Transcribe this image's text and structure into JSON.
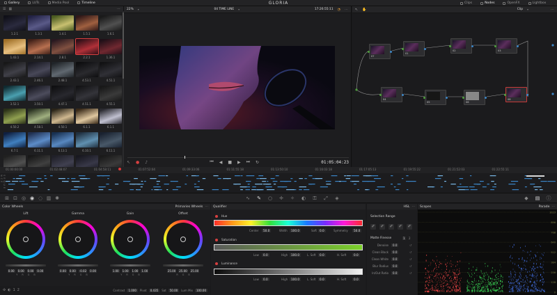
{
  "topbar": {
    "tabs": [
      {
        "label": "Gallery",
        "active": true
      },
      {
        "label": "LUTs",
        "active": false
      },
      {
        "label": "Media Pool",
        "active": false
      },
      {
        "label": "Timeline",
        "active": true
      }
    ],
    "title": "GLORIA",
    "right_tabs": [
      {
        "label": "Clips"
      },
      {
        "label": "Nodes"
      },
      {
        "label": "OpenFX"
      },
      {
        "label": "Lightbox"
      }
    ]
  },
  "gallery": {
    "thumbs": [
      {
        "label": "1.2.1",
        "colors": [
          "#101018",
          "#2a2a3e"
        ]
      },
      {
        "label": "1.3.1",
        "colors": [
          "#222244",
          "#5a5a88"
        ]
      },
      {
        "label": "1.4.1",
        "colors": [
          "#4a5a20",
          "#c8c070"
        ]
      },
      {
        "label": "1.5.1",
        "colors": [
          "#301818",
          "#a06040"
        ]
      },
      {
        "label": "1.6.1",
        "colors": [
          "#1a1a1a",
          "#505050"
        ]
      },
      {
        "label": "1.43.1",
        "colors": [
          "#a07028",
          "#e8c080"
        ]
      },
      {
        "label": "2.14.1",
        "colors": [
          "#402018",
          "#b87050"
        ]
      },
      {
        "label": "2.8.1",
        "colors": [
          "#281820",
          "#805040"
        ]
      },
      {
        "label": "2.2.1",
        "colors": [
          "#301018",
          "#b03038"
        ],
        "selected": true
      },
      {
        "label": "1.36.1",
        "colors": [
          "#201018",
          "#702830"
        ]
      },
      {
        "label": "2.43.1",
        "colors": [
          "#181818",
          "#404048"
        ]
      },
      {
        "label": "2.46.1",
        "colors": [
          "#1a1a22",
          "#484858"
        ]
      },
      {
        "label": "2.48.1",
        "colors": [
          "#202428",
          "#606870"
        ]
      },
      {
        "label": "4.53.1",
        "colors": [
          "#0e0e10",
          "#2a2a2e"
        ]
      },
      {
        "label": "4.51.1",
        "colors": [
          "#121214",
          "#303036"
        ]
      },
      {
        "label": "3.52.1",
        "colors": [
          "#102a30",
          "#4aa0b0"
        ]
      },
      {
        "label": "3.50.1",
        "colors": [
          "#181820",
          "#4c4c5c"
        ]
      },
      {
        "label": "4.47.1",
        "colors": [
          "#101012",
          "#28282e"
        ]
      },
      {
        "label": "4.51.1",
        "colors": [
          "#141416",
          "#34343a"
        ]
      },
      {
        "label": "4.55.1",
        "colors": [
          "#181818",
          "#3a3a3a"
        ]
      },
      {
        "label": "4.50.2",
        "colors": [
          "#2a3018",
          "#90a050"
        ]
      },
      {
        "label": "4.58.1",
        "colors": [
          "#283020",
          "#a0b080"
        ]
      },
      {
        "label": "4.50.1",
        "colors": [
          "#2a2418",
          "#d0b890"
        ]
      },
      {
        "label": "6.1.1",
        "colors": [
          "#3a2a18",
          "#e0c8a0"
        ]
      },
      {
        "label": "6.1.1",
        "colors": [
          "#2a2a30",
          "#c0c0d0"
        ]
      },
      {
        "label": "6.7.1",
        "colors": [
          "#102040",
          "#4080c0"
        ]
      },
      {
        "label": "6.11.1",
        "colors": [
          "#203050",
          "#5c8cc8"
        ]
      },
      {
        "label": "6.13.1",
        "colors": [
          "#183050",
          "#5888c0"
        ]
      },
      {
        "label": "6.10.1",
        "colors": [
          "#203040",
          "#6090b0"
        ]
      },
      {
        "label": "6.11.1",
        "colors": [
          "#1a2230",
          "#485868"
        ]
      },
      {
        "label": "",
        "colors": [
          "#202020",
          "#505050"
        ]
      },
      {
        "label": "",
        "colors": [
          "#181818",
          "#404040"
        ]
      },
      {
        "label": "",
        "colors": [
          "#202028",
          "#404050"
        ]
      },
      {
        "label": "",
        "colors": [
          "#181820",
          "#383848"
        ]
      },
      {
        "label": "",
        "colors": [
          "#1a1a1a",
          "#3a3a3a"
        ]
      }
    ]
  },
  "viewer": {
    "zoom": "22%",
    "timeline_name": "04 TIME LINE",
    "timecode_top": "17:26:55:11",
    "timecode": "01:05:04:23"
  },
  "nodes": {
    "mode": "Clip",
    "items": [
      {
        "label": "07"
      },
      {
        "label": "01"
      },
      {
        "label": "02"
      },
      {
        "label": "03"
      },
      {
        "label": "04"
      },
      {
        "label": "05"
      },
      {
        "label": "06"
      },
      {
        "label": "08"
      }
    ]
  },
  "timeline": {
    "timecodes": [
      "01:00:00:00",
      "01:02:48:07",
      "01:04:58:11",
      "01:07:52:04",
      "01:09:33:06",
      "01:11:55:18",
      "01:13:50:10",
      "01:16:03:18",
      "01:17:05:13",
      "01:19:55:22",
      "01:21:52:03",
      "01:22:55:11"
    ],
    "track_label": "S E Q U E N C E"
  },
  "color_wheels": {
    "title": "Color Wheels",
    "mode": "Primaries Wheels",
    "wheels": [
      {
        "name": "Lift",
        "values": [
          "0.00",
          "0.00",
          "0.00",
          "0.00"
        ],
        "channels": [
          "Y",
          "R",
          "G",
          "B"
        ]
      },
      {
        "name": "Gamma",
        "values": [
          "0.00",
          "0.00",
          "-0.02",
          "0.00"
        ],
        "channels": [
          "Y",
          "R",
          "G",
          "B"
        ]
      },
      {
        "name": "Gain",
        "values": [
          "1.00",
          "1.00",
          "1.00",
          "1.00"
        ],
        "channels": [
          "Y",
          "R",
          "G",
          "B"
        ]
      },
      {
        "name": "Offset",
        "values": [
          "25.00",
          "25.00",
          "25.00"
        ],
        "channels": [
          "R",
          "G",
          "B"
        ]
      }
    ],
    "footer": {
      "contrast_label": "Contrast",
      "contrast": "1.000",
      "pivot_label": "Pivot",
      "pivot": "0.435",
      "sat_label": "Sat",
      "sat": "50.00",
      "lummix_label": "Lum Mix",
      "lummix": "100.00"
    }
  },
  "qualifier": {
    "title": "Qualifier",
    "mode": "HSL",
    "hue": {
      "label": "Hue",
      "center_label": "Center",
      "center": "50.0",
      "width_label": "Width",
      "width": "100.0",
      "soft_label": "Soft",
      "soft": "0.0",
      "symmetry_label": "Symmetry",
      "symmetry": "50.0"
    },
    "saturation": {
      "label": "Saturation",
      "low_label": "Low",
      "low": "0.0",
      "high_label": "High",
      "high": "100.0",
      "lsoft_label": "L. Soft",
      "lsoft": "0.0",
      "hsoft_label": "H. Soft",
      "hsoft": "0.0"
    },
    "luminance": {
      "label": "Luminance",
      "low_label": "Low",
      "low": "0.0",
      "high_label": "High",
      "high": "100.0",
      "lsoft_label": "L. Soft",
      "lsoft": "0.0",
      "hsoft_label": "H. Soft",
      "hsoft": "0.0"
    }
  },
  "selection": {
    "title": "Selection Range",
    "matte_title": "Matte Finesse",
    "pages": [
      "1",
      "2"
    ],
    "rows": [
      {
        "label": "Denoise",
        "value": "0.0"
      },
      {
        "label": "Clean Black",
        "value": "0.0"
      },
      {
        "label": "Clean White",
        "value": "0.0"
      },
      {
        "label": "Blur Radius",
        "value": "0.0"
      },
      {
        "label": "In/Out Ratio",
        "value": "0.0"
      }
    ]
  },
  "scopes": {
    "title": "Scopes",
    "mode": "Parade",
    "scale": [
      "1023",
      "896",
      "768",
      "640",
      "512",
      "384",
      "256",
      "128",
      "0"
    ],
    "colors": {
      "red": "#ff4a4a",
      "green": "#3ee05a",
      "blue": "#4a7cff"
    }
  }
}
